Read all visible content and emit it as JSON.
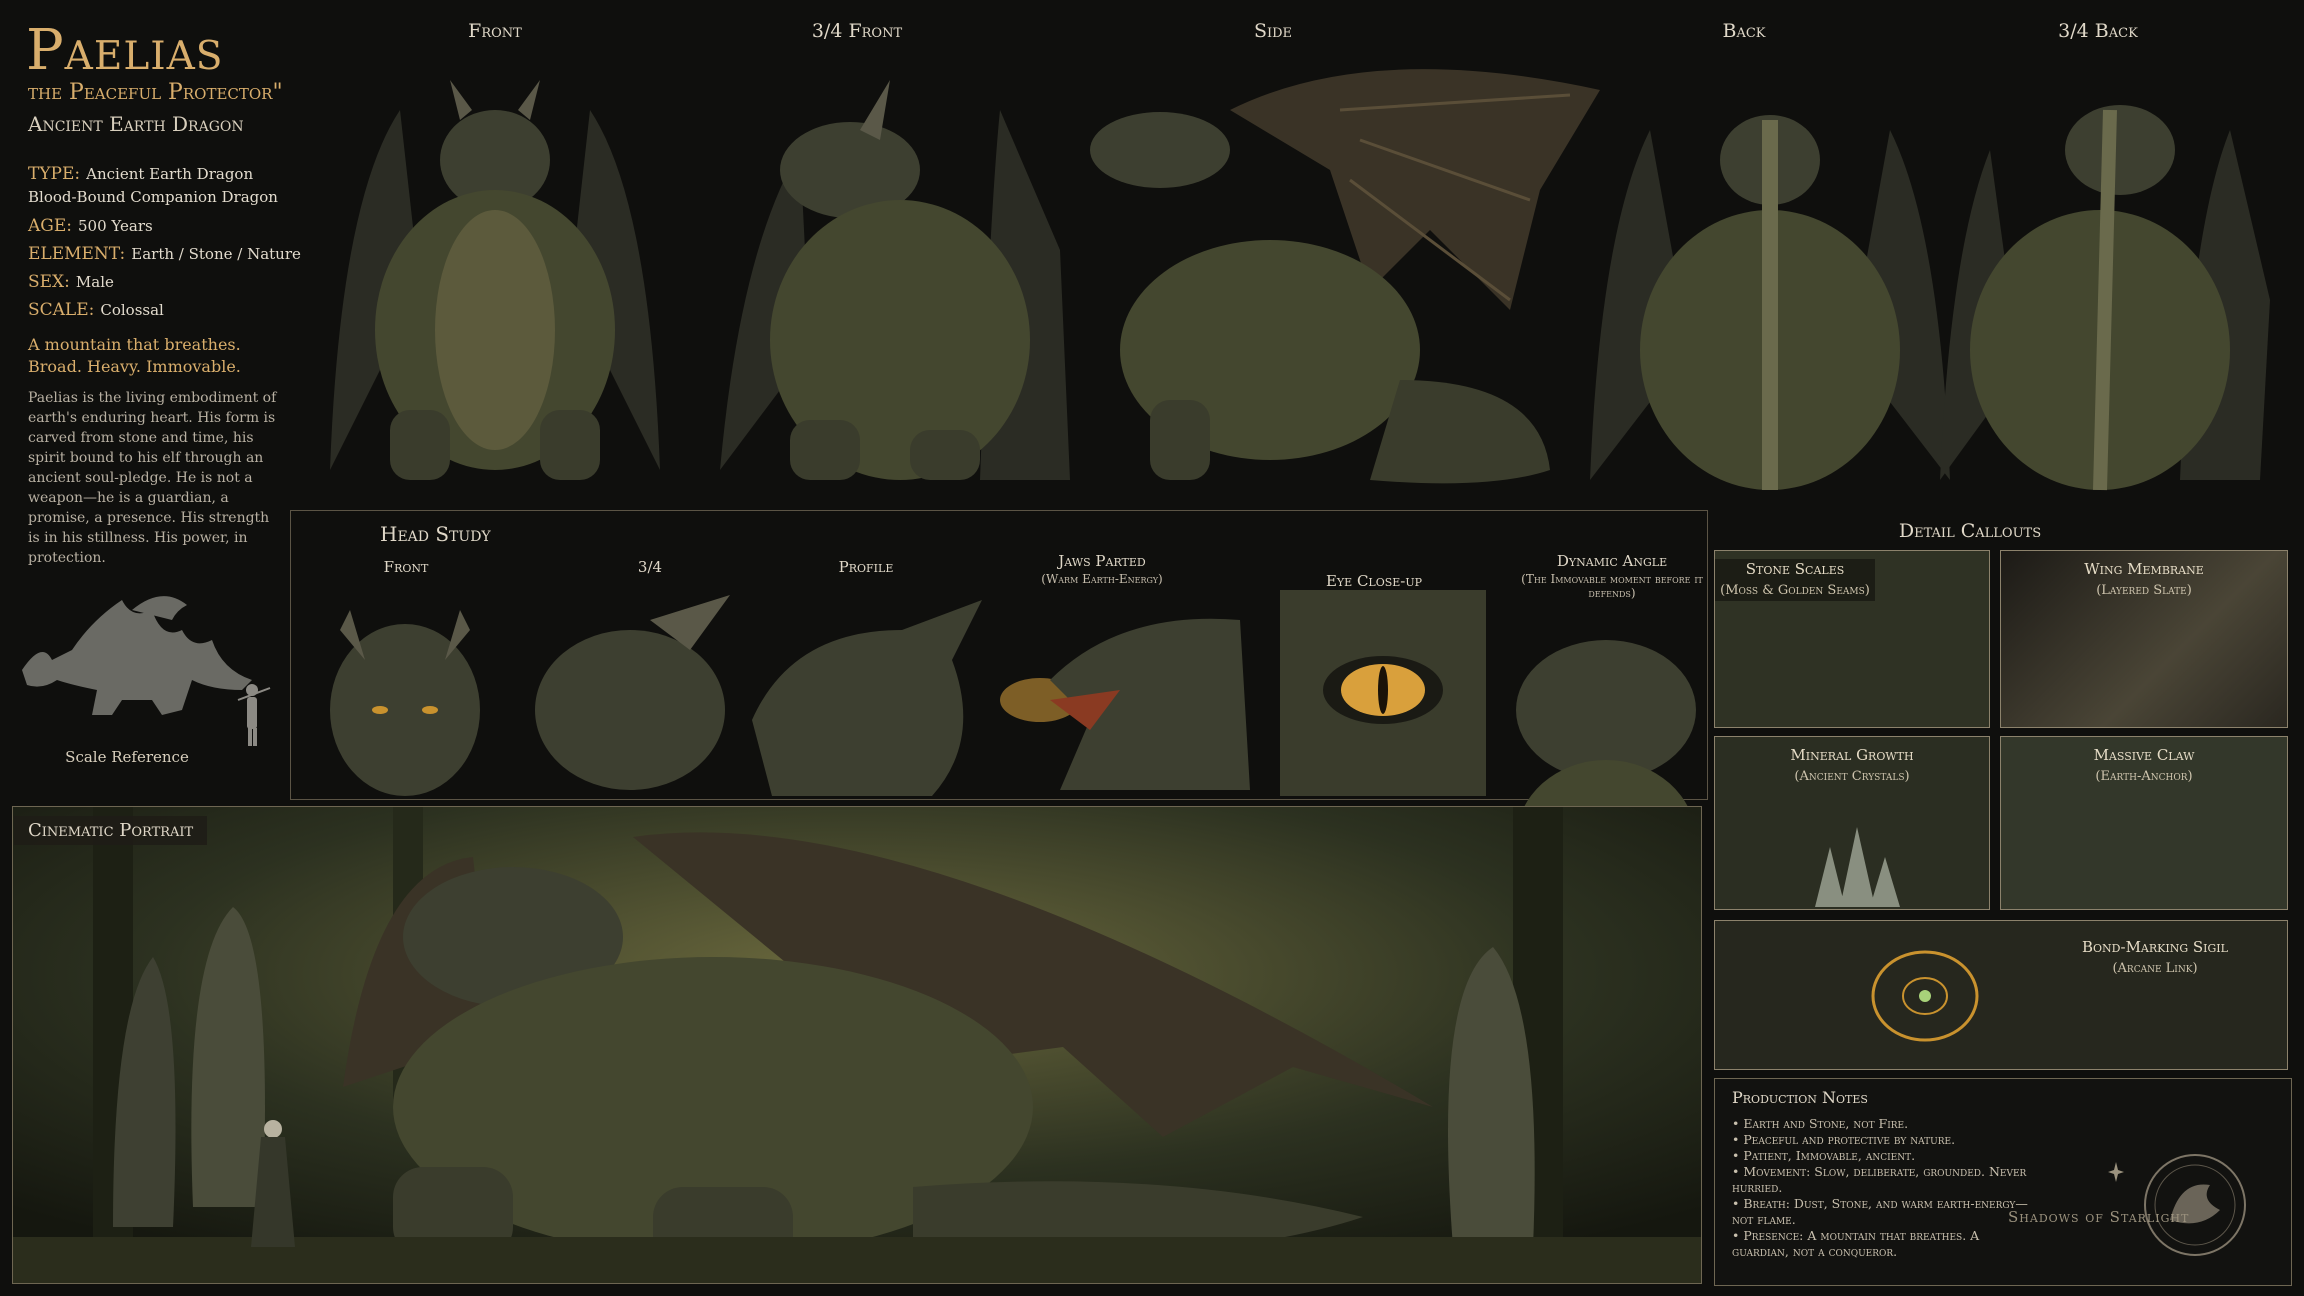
{
  "colors": {
    "gold": "#d9ae6c",
    "text": "#e2dbcd",
    "scale": "#d9a03c",
    "moss": "#4c5834"
  },
  "header": {
    "title": "Paelias",
    "subtitle": "the Peaceful Protector\"",
    "subtitle2": "Ancient Earth Dragon"
  },
  "stats": [
    {
      "key": "TYPE:",
      "value": "Ancient Earth Dragon"
    },
    {
      "key": "",
      "value": "Blood-Bound Companion Dragon"
    },
    {
      "key": "AGE:",
      "value": "500 Years"
    },
    {
      "key": "ELEMENT:",
      "value": "Earth / Stone / Nature"
    },
    {
      "key": "SEX:",
      "value": "Male"
    },
    {
      "key": "SCALE:",
      "value": "Colossal"
    }
  ],
  "tagline": [
    "A mountain that breathes.",
    "Broad. Heavy. Immovable."
  ],
  "description": "Paelias is the living embodiment of earth's enduring heart. His form is carved from stone and time, his spirit bound to his elf through an ancient soul-pledge. He is not a weapon—he is a guardian, a promise, a presence. His strength is in his stillness. His power, in protection.",
  "scale_reference": {
    "label": "Scale Reference",
    "icon": "dragon-and-elf-silhouette-icon"
  },
  "views": [
    "Front",
    "3/4 Front",
    "Side",
    "Back",
    "3/4 Back"
  ],
  "head_study": {
    "title": "Head Study",
    "items": [
      {
        "label": "Front",
        "sub": ""
      },
      {
        "label": "3/4",
        "sub": ""
      },
      {
        "label": "Profile",
        "sub": ""
      },
      {
        "label": "Jaws Parted",
        "sub": "(Warm Earth-Energy)"
      },
      {
        "label": "Eye Close-up",
        "sub": ""
      },
      {
        "label": "Dynamic Angle",
        "sub": "(The Immovable moment before it defends)"
      }
    ]
  },
  "detail_callouts": {
    "title": "Detail Callouts",
    "items": [
      {
        "label": "Stone Scales",
        "sub": "(Moss & Golden Seams)"
      },
      {
        "label": "Wing Membrane",
        "sub": "(Layered Slate)"
      },
      {
        "label": "Mineral Growth",
        "sub": "(Ancient Crystals)"
      },
      {
        "label": "Massive Claw",
        "sub": "(Earth-Anchor)"
      },
      {
        "label": "Bond-Marking Sigil",
        "sub": "(Arcane Link)"
      }
    ]
  },
  "portrait": {
    "label": "Cinematic Portrait"
  },
  "production_notes": {
    "title": "Production Notes",
    "items": [
      "Earth and Stone, not Fire.",
      "Peaceful and protective by nature.",
      "Patient, Immovable, ancient.",
      "Movement: Slow, deliberate, grounded. Never hurried.",
      "Breath: Dust, Stone, and warm earth-energy—not flame.",
      "Presence: A mountain that breathes. A guardian, not a conqueror."
    ]
  },
  "studio": {
    "name": "Shadows of Starlight",
    "icon": "dragon-emblem-icon"
  }
}
